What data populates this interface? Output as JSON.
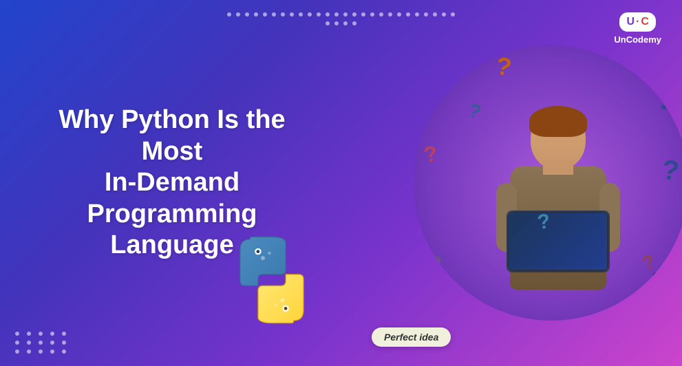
{
  "logo": {
    "badge_u": "U",
    "badge_dot": "·",
    "badge_c": "C",
    "name": "UnCodemy"
  },
  "title": {
    "line1": "Why Python Is the Most",
    "line2": "In-Demand Programming",
    "line3": "Language"
  },
  "badge": {
    "text": "Perfect idea"
  },
  "colors": {
    "bg_start": "#2244cc",
    "bg_end": "#cc44cc",
    "circle_bg": "#9944ee"
  }
}
